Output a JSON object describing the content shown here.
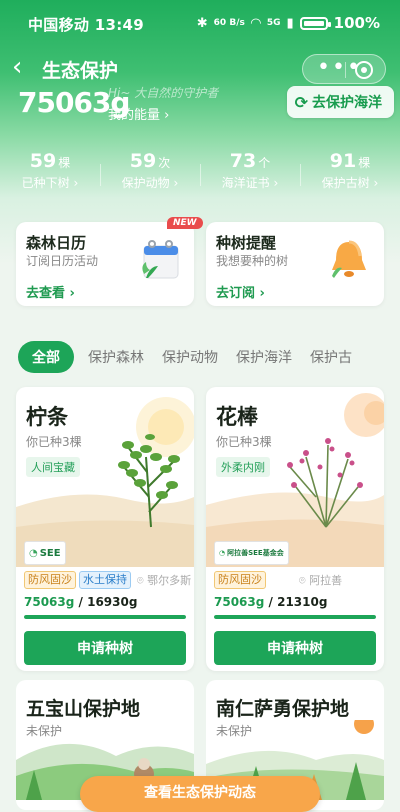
{
  "status_bar": {
    "carrier_time": "中国移动 13:49",
    "signal_speed": "60 B/s",
    "network": "5G",
    "battery": "100%"
  },
  "nav": {
    "title": "生态保护"
  },
  "energy": {
    "value": "75063g",
    "label": "我的能量",
    "slogan": "Hi~ 大自然的守护者",
    "ocean_button": "去保护海洋"
  },
  "stats": [
    {
      "num": "59",
      "unit": "棵",
      "desc": "已种下树"
    },
    {
      "num": "59",
      "unit": "次",
      "desc": "保护动物"
    },
    {
      "num": "73",
      "unit": "个",
      "desc": "海洋证书"
    },
    {
      "num": "91",
      "unit": "棵",
      "desc": "保护古树"
    }
  ],
  "promo_cards": [
    {
      "title": "森林日历",
      "subtitle": "订阅日历活动",
      "link": "去查看",
      "badge": "NEW"
    },
    {
      "title": "种树提醒",
      "subtitle": "我想要种的树",
      "link": "去订阅"
    }
  ],
  "tabs": [
    "全部",
    "保护森林",
    "保护动物",
    "保护海洋",
    "保护古"
  ],
  "trees": [
    {
      "name": "柠条",
      "planted": "你已种3棵",
      "chip": "人间宝藏",
      "org_logo": "SEE",
      "tags": [
        "防风固沙",
        "水土保持"
      ],
      "location": "鄂尔多斯",
      "energy_have": "75063g",
      "energy_need": "16930g",
      "progress": 1.0,
      "button": "申请种树"
    },
    {
      "name": "花棒",
      "planted": "你已种3棵",
      "chip": "外柔内刚",
      "org_logo": "阿拉善SEE基金会",
      "tags": [
        "防风固沙"
      ],
      "location": "阿拉善",
      "energy_have": "75063g",
      "energy_need": "21310g",
      "progress": 1.0,
      "button": "申请种树"
    }
  ],
  "areas": [
    {
      "name": "五宝山保护地",
      "status": "未保护"
    },
    {
      "name": "南仁萨勇保护地",
      "status": "未保护"
    }
  ],
  "floating_button": "查看生态保护动态",
  "colors": {
    "primary": "#1da558",
    "accent_orange": "#f8a64a"
  }
}
